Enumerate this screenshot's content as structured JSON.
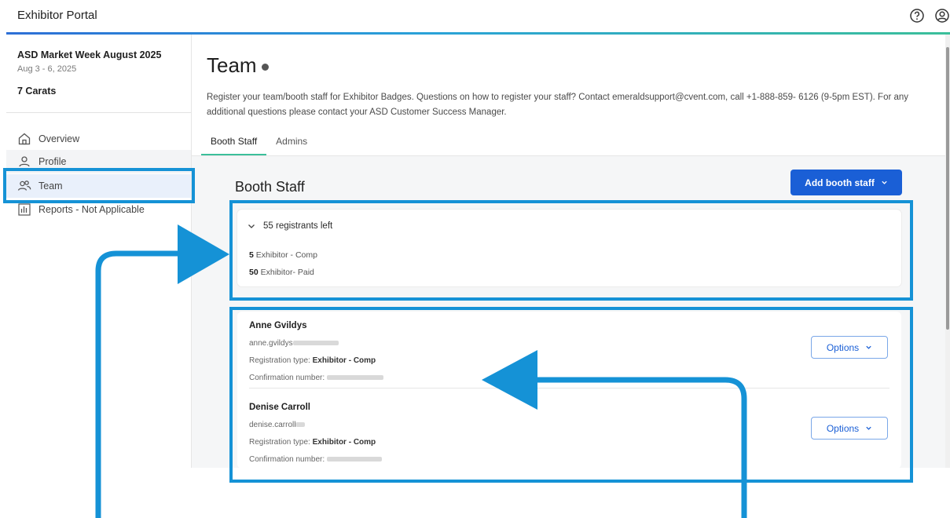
{
  "header": {
    "app_title": "Exhibitor Portal"
  },
  "sidebar": {
    "event_name": "ASD Market Week August 2025",
    "event_dates": "Aug 3 - 6, 2025",
    "company": "7 Carats",
    "items": [
      {
        "label": "Overview",
        "icon": "home-icon"
      },
      {
        "label": "Profile",
        "icon": "person-icon"
      },
      {
        "label": "Team",
        "icon": "people-icon",
        "selected": true
      },
      {
        "label": "Reports - Not Applicable",
        "icon": "chart-icon"
      }
    ]
  },
  "main": {
    "title": "Team",
    "description": "Register your team/booth staff for Exhibitor Badges. Questions on how to register your staff? Contact emeraldsupport@cvent.com, call +1-888-859- 6126 (9-5pm EST). For any additional questions please contact your ASD Customer Success Manager.",
    "tabs": [
      {
        "label": "Booth Staff",
        "active": true
      },
      {
        "label": "Admins",
        "active": false
      }
    ],
    "section_title": "Booth Staff",
    "add_button_label": "Add booth staff",
    "registrants": {
      "summary": "55 registrants left",
      "lines": [
        {
          "count": "5",
          "type": "Exhibitor - Comp"
        },
        {
          "count": "50",
          "type": "Exhibitor- Paid"
        }
      ]
    },
    "staff": [
      {
        "name": "Anne Gvildys",
        "email_visible": "anne.gvildys",
        "registration_label": "Registration type:",
        "registration_type": "Exhibitor - Comp",
        "confirmation_label": "Confirmation number:",
        "options_label": "Options"
      },
      {
        "name": "Denise Carroll",
        "email_visible": "denise.carroll",
        "registration_label": "Registration type:",
        "registration_type": "Exhibitor - Comp",
        "confirmation_label": "Confirmation number:",
        "options_label": "Options"
      }
    ]
  },
  "colors": {
    "primary": "#1a5fd6",
    "annotation": "#1592d6",
    "active_tab": "#3bbf9a"
  }
}
